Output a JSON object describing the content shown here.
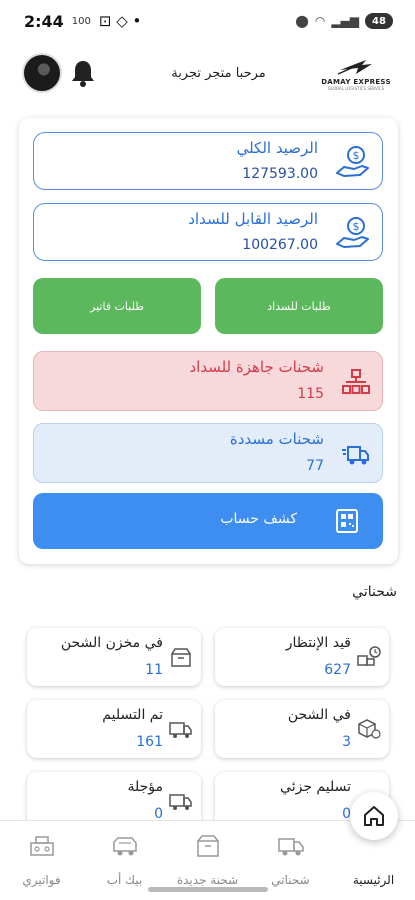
{
  "status_bar": {
    "time": "2:44",
    "mini_text": "100",
    "battery": "48"
  },
  "header": {
    "greeting": "مرحبا متجر تجربة",
    "logo_text": "DAMAY EXPRESS",
    "logo_subtext": "GLOBAL LOGISTICS SERVICE"
  },
  "balances": {
    "total_label": "الرصيد الكلي",
    "total_value": "127593.00",
    "payable_label": "الرصيد القابل للسداد",
    "payable_value": "100267.00"
  },
  "actions": {
    "payment_requests": "طلبات للسداد",
    "invoice_requests": "طلبات فاتير"
  },
  "ready_for_payment": {
    "label": "شحنات جاهزة للسداد",
    "value": "115"
  },
  "paid_shipments": {
    "label": "شحنات مسددة",
    "value": "77"
  },
  "statement": {
    "label": "كشف حساب"
  },
  "my_shipments": {
    "title": "شحناتي",
    "items": [
      {
        "label": "قيد الإنتظار",
        "value": "627"
      },
      {
        "label": "في مخزن الشحن",
        "value": "11"
      },
      {
        "label": "في الشحن",
        "value": "3"
      },
      {
        "label": "تم التسليم",
        "value": "161"
      },
      {
        "label": "تسليم جزئي",
        "value": "0"
      },
      {
        "label": "مؤجلة",
        "value": "0"
      }
    ]
  },
  "navbar": {
    "items": [
      {
        "label": "الرئيسية",
        "icon": "home-icon"
      },
      {
        "label": "شحناتي",
        "icon": "truck-icon"
      },
      {
        "label": "شحنة جديدة",
        "icon": "box-icon"
      },
      {
        "label": "بيك أب",
        "icon": "pickup-van-icon"
      },
      {
        "label": "فواتيري",
        "icon": "invoice-icon"
      }
    ]
  },
  "colors": {
    "primary_blue": "#3d8ef0",
    "green": "#5cb85c",
    "red_text": "#d23b48",
    "red_bg": "#f7d9db",
    "blue_bg": "#e3ecf9"
  }
}
